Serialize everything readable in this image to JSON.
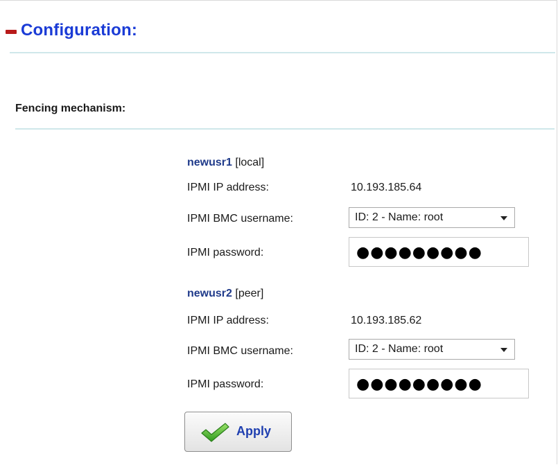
{
  "header": {
    "title": "Configuration:"
  },
  "fencing": {
    "heading": "Fencing mechanism:",
    "nodes": [
      {
        "name": "newusr1",
        "role": "[local]",
        "ip_label": "IPMI IP address:",
        "ip_value": "10.193.185.64",
        "username_label": "IPMI BMC username:",
        "username_selected": "ID: 2 - Name: root",
        "password_label": "IPMI password:",
        "password_mask": "●●●●●●●●●"
      },
      {
        "name": "newusr2",
        "role": "[peer]",
        "ip_label": "IPMI IP address:",
        "ip_value": "10.193.185.62",
        "username_label": "IPMI BMC username:",
        "username_selected": "ID: 2 - Name: root",
        "password_label": "IPMI password:",
        "password_mask": "●●●●●●●●●"
      }
    ],
    "apply_label": "Apply"
  },
  "colors": {
    "title": "#1a3bd6",
    "node_name": "#1f3a8a",
    "collapse_icon": "#b81a1a",
    "divider": "#cfe7ea"
  },
  "icons": {
    "collapse": "minus-collapse-icon",
    "apply": "green-checkmark-icon",
    "dropdown": "chevron-down-icon"
  }
}
